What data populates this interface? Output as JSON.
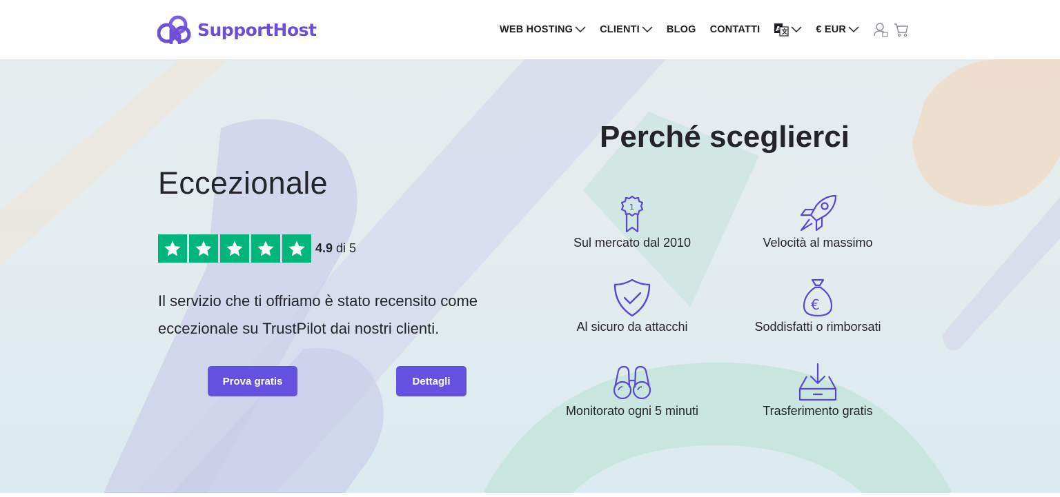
{
  "header": {
    "logo_text": "SupportHost",
    "nav": [
      {
        "label": "WEB HOSTING",
        "has_dropdown": true
      },
      {
        "label": "CLIENTI",
        "has_dropdown": true
      },
      {
        "label": "BLOG",
        "has_dropdown": false
      },
      {
        "label": "CONTATTI",
        "has_dropdown": false
      }
    ],
    "language_icon": "translate-icon",
    "currency": "€ EUR",
    "account_icon": "user-icon",
    "cart_icon": "cart-icon"
  },
  "hero": {
    "headline": "Eccezionale",
    "rating": {
      "score": "4.9",
      "suffix": "di 5",
      "stars": 5,
      "star_color": "#00b67a"
    },
    "description": "Il servizio che ti offriamo è stato recensito come eccezionale su TrustPilot dai nostri clienti.",
    "buttons": {
      "trial": "Prova gratis",
      "details": "Dettagli"
    }
  },
  "why": {
    "title": "Perché sceglierci",
    "features": [
      {
        "icon": "award-ribbon-icon",
        "label": "Sul mercato dal 2010"
      },
      {
        "icon": "rocket-icon",
        "label": "Velocità al massimo"
      },
      {
        "icon": "shield-check-icon",
        "label": "Al sicuro da attacchi"
      },
      {
        "icon": "money-bag-euro-icon",
        "label": "Soddisfatti o rimborsati"
      },
      {
        "icon": "binoculars-icon",
        "label": "Monitorato ogni 5 minuti"
      },
      {
        "icon": "download-tray-icon",
        "label": "Trasferimento gratis"
      }
    ]
  },
  "colors": {
    "brand": "#6c4fd6",
    "button": "#6451e0",
    "icon_stroke": "#5b45d6",
    "trustpilot_green": "#00b67a"
  }
}
